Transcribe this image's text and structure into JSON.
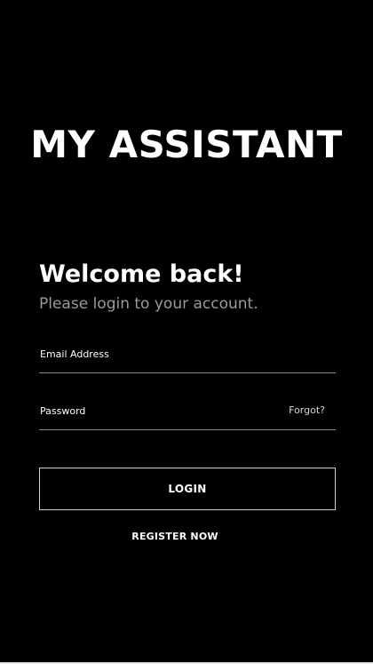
{
  "app": {
    "title": "MY ASSISTANT"
  },
  "welcome": {
    "heading": "Welcome back!",
    "subtitle": "Please login to your account."
  },
  "form": {
    "email": {
      "placeholder": "Email Address",
      "value": ""
    },
    "password": {
      "placeholder": "Password",
      "value": "",
      "forgot_label": "Forgot?"
    },
    "login_label": "LOGIN",
    "register_label": "REGISTER NOW"
  },
  "colors": {
    "background": "#000000",
    "text": "#ffffff",
    "subtitle": "#9a9a9a",
    "underline": "#8a8a8a",
    "button_border": "#cfcfcf"
  }
}
